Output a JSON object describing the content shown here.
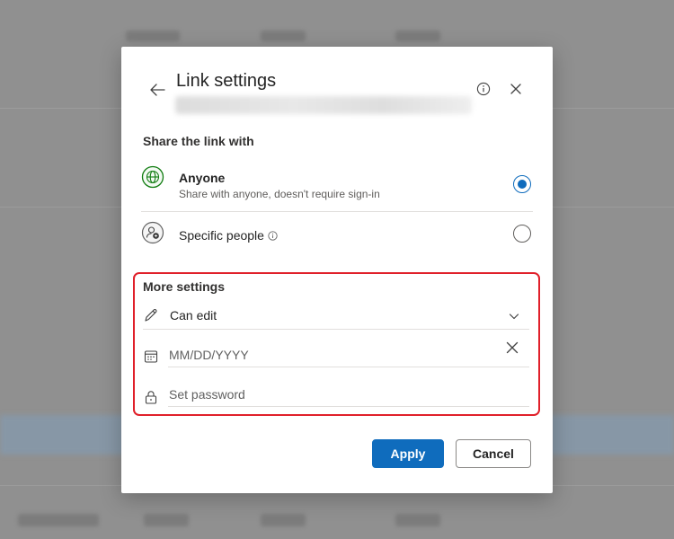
{
  "dialog": {
    "title": "Link settings",
    "share_section_label": "Share the link with",
    "options": [
      {
        "title": "Anyone",
        "description": "Share with anyone, doesn't require sign-in",
        "icon": "globe-icon",
        "selected": true
      },
      {
        "title": "Specific people",
        "description": "",
        "icon": "people-icon",
        "selected": false
      }
    ],
    "more_settings": {
      "label": "More settings",
      "permission": "Can edit",
      "date_placeholder": "MM/DD/YYYY",
      "password_placeholder": "Set password"
    },
    "apply_label": "Apply",
    "cancel_label": "Cancel"
  },
  "colors": {
    "accent": "#0f6cbd",
    "highlight_border": "#e0202a",
    "globe_green": "#107c10"
  }
}
